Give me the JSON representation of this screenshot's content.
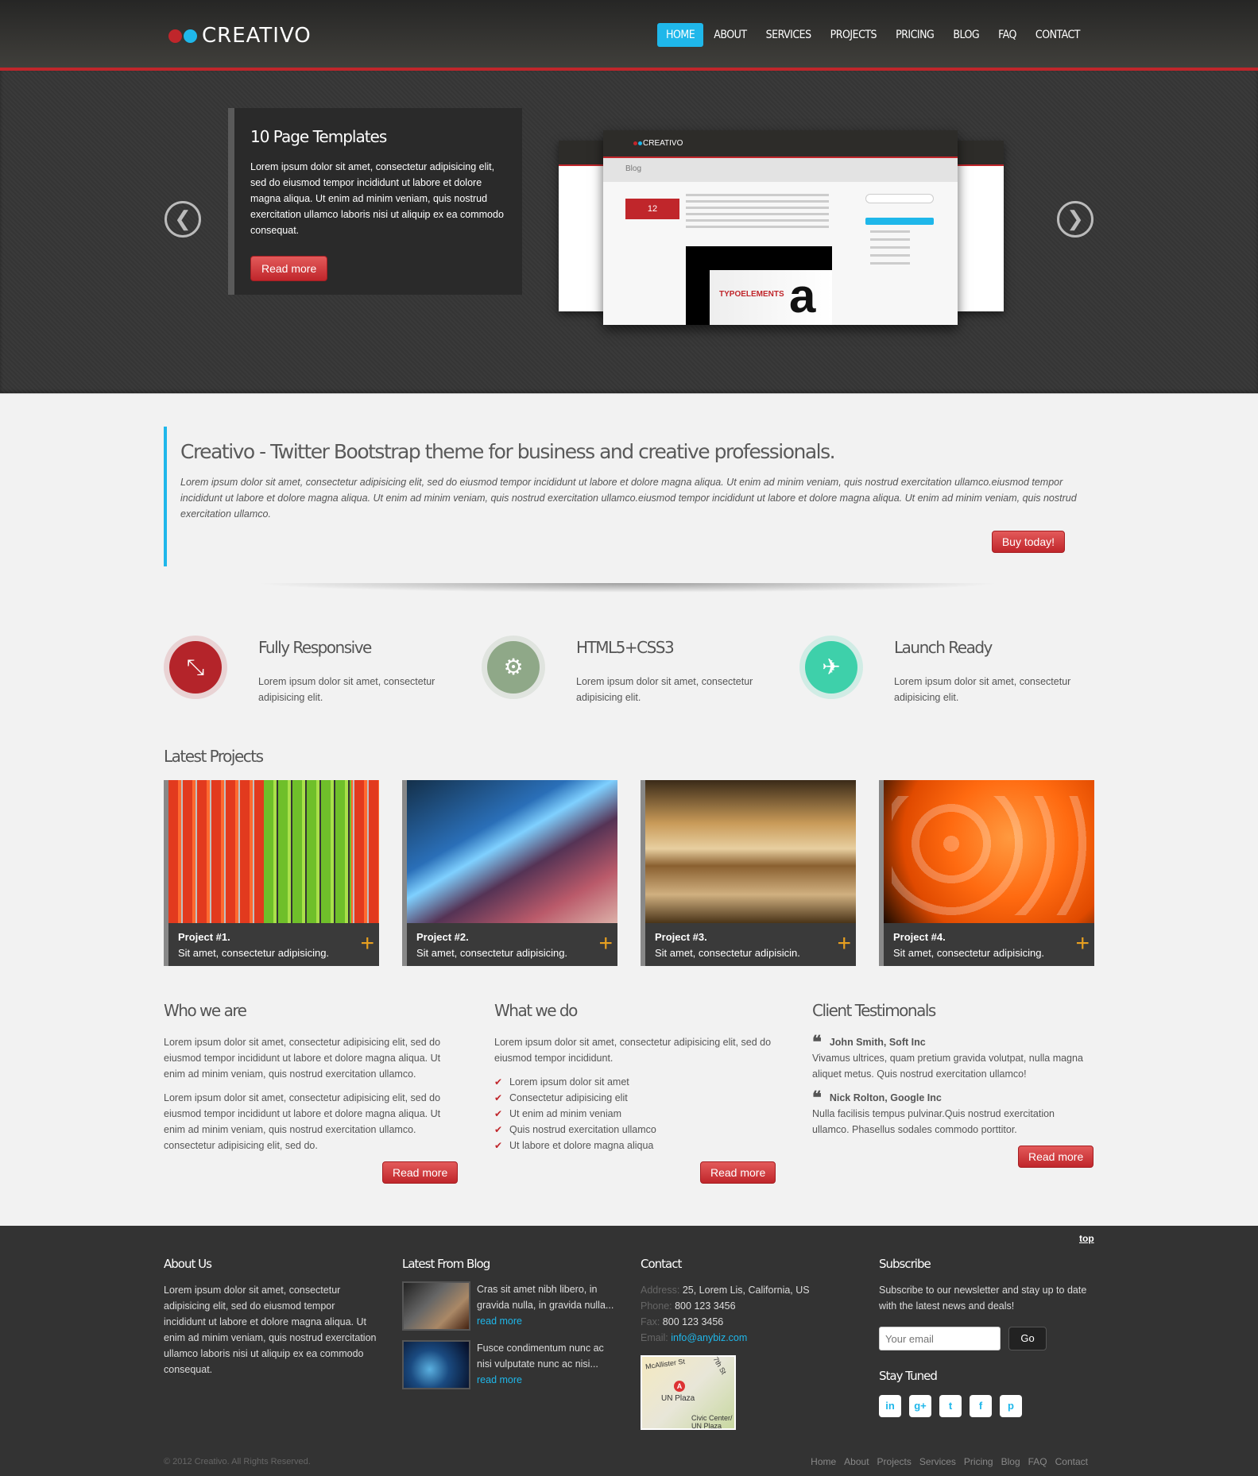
{
  "header": {
    "logo_text": "CREATIVO",
    "nav": [
      "HOME",
      "ABOUT",
      "SERVICES",
      "PROJECTS",
      "PRICING",
      "BLOG",
      "FAQ",
      "CONTACT"
    ],
    "active_index": 0
  },
  "slider": {
    "title": "10 Page Templates",
    "text": "Lorem ipsum dolor sit amet, consectetur adipisicing elit, sed do eiusmod tempor incididunt ut labore et dolore magna aliqua. Ut enim ad minim veniam, quis nostrud exercitation ullamco laboris nisi ut aliquip ex ea commodo consequat.",
    "button": "Read more",
    "prev_icon": "chevron-left-icon",
    "next_icon": "chevron-right-icon",
    "mock": {
      "logo": "CREATIVO",
      "page_title": "Blog",
      "date": "12",
      "img_text": "TYPOELEMENTS",
      "img_letter": "a"
    }
  },
  "intro": {
    "title": "Creativo - Twitter Bootstrap theme for business and creative professionals.",
    "text": "Lorem ipsum dolor sit amet, consectetur adipisicing elit, sed do eiusmod tempor incididunt ut labore et dolore magna aliqua. Ut enim ad minim veniam, quis nostrud exercitation ullamco.eiusmod tempor incididunt ut labore et dolore magna aliqua. Ut enim ad minim veniam, quis nostrud exercitation ullamco.eiusmod tempor incididunt ut labore et dolore magna aliqua. Ut enim ad minim veniam, quis nostrud exercitation ullamco.",
    "button": "Buy today!"
  },
  "features": [
    {
      "title": "Fully Responsive",
      "text": "Lorem ipsum dolor sit amet, consectetur adipisicing elit.",
      "icon": "compress-arrows-icon",
      "color": "#b4242a"
    },
    {
      "title": "HTML5+CSS3",
      "text": "Lorem ipsum dolor sit amet, consectetur adipisicing elit.",
      "icon": "gears-icon",
      "color": "#8fa888"
    },
    {
      "title": "Launch Ready",
      "text": "Lorem ipsum dolor sit amet, consectetur adipisicing elit.",
      "icon": "airplane-icon",
      "color": "#3ed0aa"
    }
  ],
  "projects": {
    "title": "Latest Projects",
    "items": [
      {
        "name": "Project #1.",
        "desc": "Sit amet, consectetur adipisicing."
      },
      {
        "name": "Project #2.",
        "desc": "Sit amet, consectetur adipisicing."
      },
      {
        "name": "Project #3.",
        "desc": "Sit amet, consectetur adipisicin."
      },
      {
        "name": "Project #4.",
        "desc": "Sit amet, consectetur adipisicing."
      }
    ]
  },
  "who": {
    "title": "Who we are",
    "p1": "Lorem ipsum dolor sit amet, consectetur adipisicing elit, sed do eiusmod tempor incididunt ut labore et dolore magna aliqua. Ut enim ad minim veniam, quis nostrud exercitation ullamco.",
    "p2": "Lorem ipsum dolor sit amet, consectetur adipisicing elit, sed do eiusmod tempor incididunt ut labore et dolore magna aliqua. Ut enim ad minim veniam, quis nostrud exercitation ullamco. consectetur adipisicing elit, sed do.",
    "button": "Read more"
  },
  "what": {
    "title": "What we do",
    "p1": "Lorem ipsum dolor sit amet, consectetur adipisicing elit, sed do eiusmod tempor incididunt.",
    "list": [
      "Lorem ipsum dolor sit amet",
      "Consectetur adipisicing elit",
      "Ut enim ad minim veniam",
      "Quis nostrud exercitation ullamco",
      "Ut labore et dolore magna aliqua"
    ],
    "button": "Read more"
  },
  "testimonials": {
    "title": "Client Testimonals",
    "items": [
      {
        "name": "John Smith, Soft Inc",
        "text": "Vivamus ultrices, quam pretium gravida volutpat, nulla magna aliquet metus. Quis nostrud exercitation ullamco!"
      },
      {
        "name": "Nick Rolton, Google Inc",
        "text": "Nulla facilisis tempus pulvinar.Quis nostrud exercitation ullamco. Phasellus sodales commodo porttitor."
      }
    ],
    "button": "Read more"
  },
  "footer": {
    "top_link": "top",
    "about": {
      "title": "About Us",
      "text": "Lorem ipsum dolor sit amet, consectetur adipisicing elit, sed do eiusmod tempor incididunt ut labore et dolore magna aliqua. Ut enim ad minim veniam, quis nostrud exercitation ullamco laboris nisi ut aliquip ex ea commodo consequat."
    },
    "blog": {
      "title": "Latest From Blog",
      "items": [
        {
          "text": "Cras sit amet nibh libero, in gravida nulla, in gravida nulla...",
          "link": "read more"
        },
        {
          "text": "Fusce condimentum nunc ac nisi vulputate nunc ac nisi...",
          "link": "read more"
        }
      ]
    },
    "contact": {
      "title": "Contact",
      "address_label": "Address:",
      "address": "25, Lorem Lis, California, US",
      "phone_label": "Phone:",
      "phone": "800 123 3456",
      "fax_label": "Fax:",
      "fax": "800 123 3456",
      "email_label": "Email:",
      "email": "info@anybiz.com",
      "map_street1": "McAllister St",
      "map_street2": "7th St",
      "map_place": "UN Plaza",
      "map_pin": "A",
      "map_station": "Civic Center/ UN Plaza"
    },
    "subscribe": {
      "title": "Subscribe",
      "text": "Subscribe to our newsletter and stay up to date with the latest news and deals!",
      "placeholder": "Your email",
      "button": "Go",
      "stay_title": "Stay Tuned",
      "social": [
        "in",
        "g+",
        "t",
        "f",
        "p"
      ],
      "social_icons": [
        "linkedin-icon",
        "google-plus-icon",
        "twitter-icon",
        "facebook-icon",
        "pinterest-icon"
      ]
    },
    "copyright": "© 2012 Creativo. All Rights Reserved.",
    "nav": [
      "Home",
      "About",
      "Projects",
      "Services",
      "Pricing",
      "Blog",
      "FAQ",
      "Contact"
    ]
  }
}
